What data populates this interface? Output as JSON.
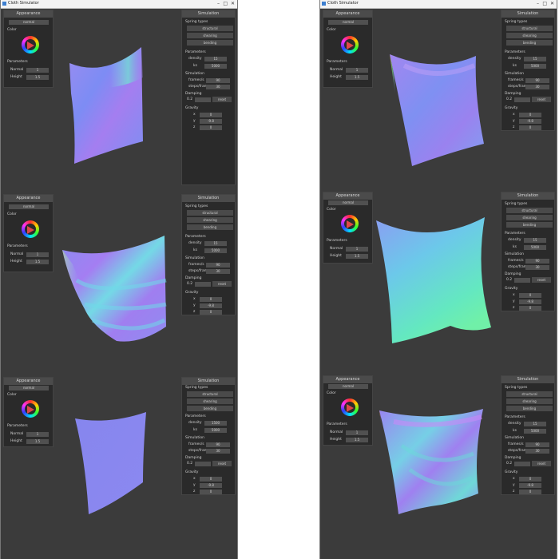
{
  "window_title": "Cloth Simulator",
  "window_controls": {
    "minimize": "–",
    "maximize": "□",
    "close": "✕"
  },
  "appearance_panel": {
    "header": "Appearance",
    "shading_mode": "normal",
    "color_label": "Color",
    "parameters_label": "Parameters",
    "params": [
      {
        "label": "Normal",
        "value": "1"
      },
      {
        "label": "Height",
        "value": "1.5"
      }
    ]
  },
  "simulation_panel": {
    "header": "Simulation",
    "spring_types_label": "Spring types",
    "spring_types": [
      "structural",
      "shearing",
      "bending"
    ],
    "parameters_label": "Parameters",
    "density_label": "density",
    "ks_label": "ks",
    "ks_value": "5000",
    "simulation_label": "Simulation",
    "frames_label": "frames/s",
    "frames_value": "90",
    "steps_label": "steps/frame",
    "steps_value": "30",
    "damping_label": "Damping",
    "damping_value": "0.2",
    "reset_label": "reset",
    "gravity_label": "Gravity",
    "gravity": [
      {
        "axis": "x",
        "value": "0"
      },
      {
        "axis": "y",
        "value": "-9.8"
      },
      {
        "axis": "z",
        "value": "0"
      }
    ]
  },
  "scenes": [
    {
      "id": "top-left",
      "density": "15"
    },
    {
      "id": "top-right",
      "density": "15"
    },
    {
      "id": "mid-left",
      "density": "15"
    },
    {
      "id": "mid-right",
      "density": "15"
    },
    {
      "id": "bottom-left",
      "density": "1500"
    },
    {
      "id": "bottom-right",
      "density": "15"
    }
  ],
  "colors": {
    "window_bg": "#3b3b3b",
    "panel_bg": "#2a2a2a",
    "panel_header": "#4b4b4b",
    "field_bg": "#505050"
  }
}
